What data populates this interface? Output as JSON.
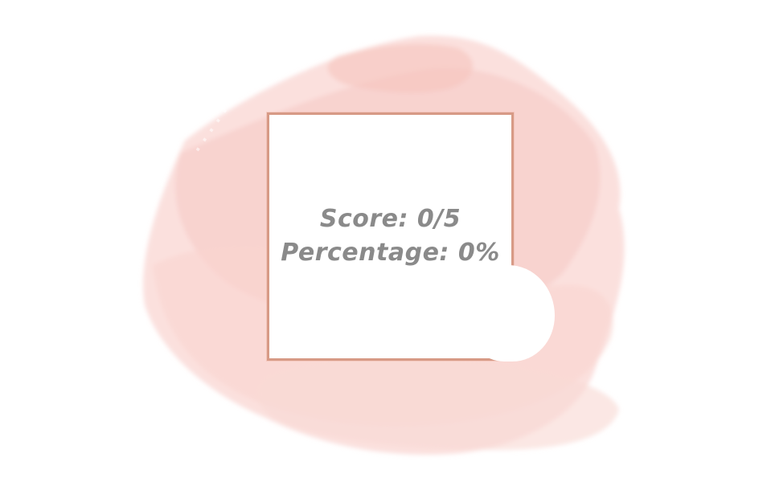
{
  "result": {
    "score_label": "Score: 0/5",
    "percentage_label": "Percentage: 0%"
  },
  "colors": {
    "watercolor": "#f7cfca",
    "frame": "#d79a86",
    "text": "#8a8a8a"
  }
}
